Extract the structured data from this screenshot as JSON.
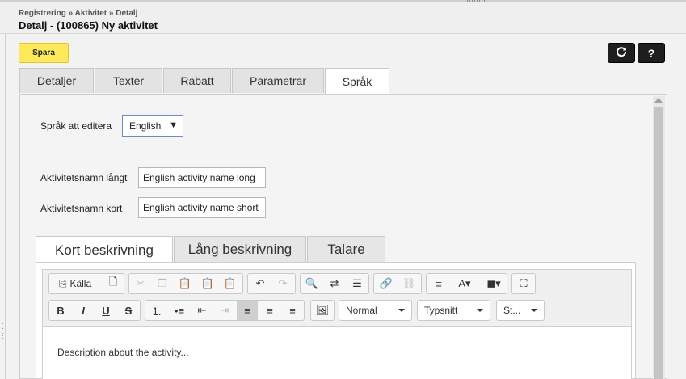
{
  "breadcrumb": "Registrering » Aktivitet » Detalj",
  "page_title": "Detalj - (100865) Ny aktivitet",
  "save_label": "Spara",
  "help_label": "?",
  "tabs": [
    "Detaljer",
    "Texter",
    "Rabatt",
    "Parametrar",
    "Språk"
  ],
  "active_tab": "Språk",
  "language": {
    "label": "Språk att editera",
    "value": "English"
  },
  "name_long": {
    "label": "Aktivitetsnamn långt",
    "value": "English activity name long"
  },
  "name_short": {
    "label": "Aktivitetsnamn kort",
    "value": "English activity name short"
  },
  "editor_tabs": [
    "Kort beskrivning",
    "Lång beskrivning",
    "Talare"
  ],
  "active_editor_tab": "Kort beskrivning",
  "toolbar": {
    "source_label": "Källa",
    "format_combo": "Normal",
    "font_combo": "Typsnitt",
    "size_combo": "St..."
  },
  "editor_content": "Description about the activity...",
  "colors": {
    "save_bg": "#fde95a",
    "dark_btn": "#1e1e1e",
    "select_border": "#6d8bc2"
  }
}
